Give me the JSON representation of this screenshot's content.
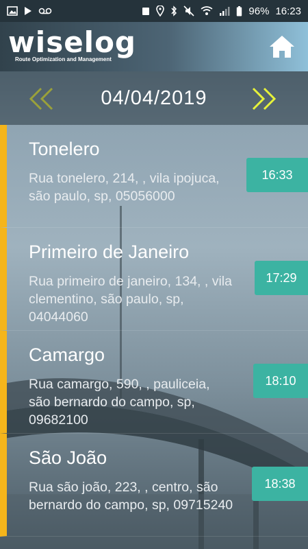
{
  "status_bar": {
    "battery": "96%",
    "clock": "16:23"
  },
  "header": {
    "logo_text": "wiselog",
    "logo_tagline": "Route Optimization and Management"
  },
  "date_nav": {
    "date": "04/04/2019"
  },
  "stops": [
    {
      "name": "Tonelero",
      "address": "Rua tonelero, 214, , vila ipojuca, são paulo, sp, 05056000",
      "time": "16:33"
    },
    {
      "name": "Primeiro de Janeiro",
      "address": "Rua primeiro de janeiro, 134, , vila clementino, são paulo, sp, 04044060",
      "time": "17:29"
    },
    {
      "name": "Camargo",
      "address": "Rua camargo, 590, , pauliceia, são bernardo do campo, sp, 09682100",
      "time": "18:10"
    },
    {
      "name": "São João",
      "address": "Rua são joão, 223, , centro, são bernardo do campo, sp, 09715240",
      "time": "18:38"
    }
  ],
  "colors": {
    "accent_yellow": "#f5b51b",
    "time_badge": "#3cb3a2",
    "arrow_prev": "#9aa13a",
    "arrow_next": "#e6f23a"
  }
}
